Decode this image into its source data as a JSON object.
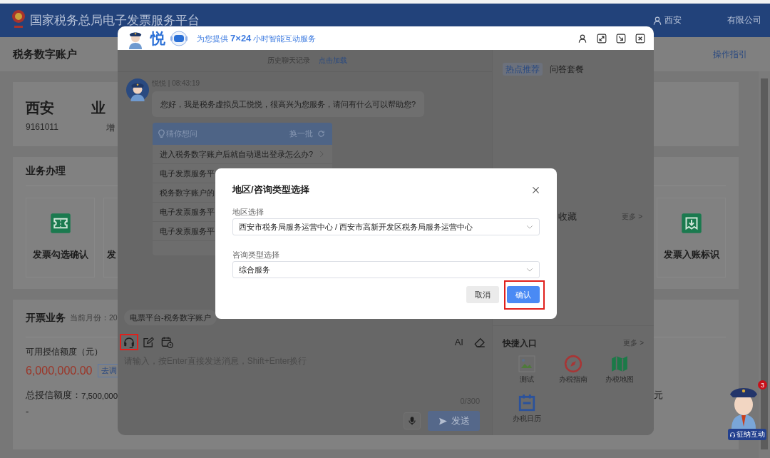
{
  "header": {
    "title": "国家税务总局电子发票服务平台",
    "user_name_start": "西安",
    "user_name_end": "有限公司"
  },
  "page": {
    "title": "税务数字账户",
    "guide_link": "操作指引"
  },
  "account_card": {
    "name_start": "西安",
    "name_end": "业",
    "tax_id": "9161011",
    "type": "增"
  },
  "business_card": {
    "title": "业务办理",
    "tiles": [
      {
        "label": "发票勾选确认",
        "kind": "ticket"
      },
      {
        "label": "发",
        "kind": "covered"
      }
    ],
    "favorite_tiles": [
      {
        "label": "发票入账标识",
        "kind": "inbox"
      }
    ]
  },
  "invoicing_card": {
    "title": "开票业务",
    "current_month": "当前月份：20",
    "credit_label": "可用授信额度（元）",
    "credit_amount": "6,000,000.00",
    "adjust_button": "去调",
    "total_label": "总授信额度：",
    "total_amount": "7,500,000",
    "dash": "-",
    "unit": "元"
  },
  "chat": {
    "brand": "悦",
    "tagline": "为您提供 **7×24** 小时智能互动服务",
    "header_buttons": [
      {
        "kind": "person"
      },
      {
        "kind": "expand"
      },
      {
        "kind": "shrink"
      },
      {
        "kind": "close"
      }
    ],
    "history": {
      "label": "历史聊天记录",
      "link": "点击加载"
    },
    "messages": [
      {
        "sender": "悦悦 | 08:43:19",
        "text": "您好，我是税务虚拟员工悦悦，很高兴为您服务，请问有什么可以帮助您?"
      }
    ],
    "suggestions": {
      "title": "猜你想问",
      "refresh": "换一批",
      "items": [
        "进入税务数字账户后就自动退出登录怎么办?",
        "电子发票服务平",
        "税务数字账户的",
        "电子发票服务平",
        "电子发票服务平"
      ]
    },
    "context_chip": "电票平台-税务数字账户",
    "tools": [
      {
        "kind": "headset",
        "highlighted": true
      },
      {
        "kind": "edit",
        "highlighted": false
      },
      {
        "kind": "calendar",
        "highlighted": false
      }
    ],
    "ai_label": "AI",
    "input": {
      "placeholder": "请输入，按Enter直接发送消息，Shift+Enter换行",
      "counter": "0/300"
    },
    "send_button": {
      "label": "发送",
      "disabled": true
    },
    "side_tabs": [
      {
        "label": "热点推荐",
        "selected": true
      },
      {
        "label": "问答套餐",
        "selected": false
      }
    ],
    "favorites": {
      "title": "收藏",
      "more": "更多 >"
    },
    "shortcuts": {
      "title": "快捷入口",
      "more": "更多 >",
      "items": [
        {
          "label": "测试",
          "kind": "broken-image"
        },
        {
          "label": "办税指南",
          "kind": "compass"
        },
        {
          "label": "办税地图",
          "kind": "map"
        },
        {
          "label": "办税日历",
          "kind": "calendar"
        }
      ]
    }
  },
  "dialog": {
    "title": "地区/咨询类型选择",
    "fields": [
      {
        "label": "地区选择",
        "value": "西安市税务局服务运营中心 / 西安市高新开发区税务局服务运营中心"
      },
      {
        "label": "咨询类型选择",
        "value": "综合服务"
      }
    ],
    "buttons": [
      {
        "label": "取消",
        "kind": "secondary",
        "highlighted": false
      },
      {
        "label": "确认",
        "kind": "primary",
        "highlighted": true
      }
    ]
  },
  "launcher": {
    "badge": "3",
    "label": "征纳互动"
  }
}
